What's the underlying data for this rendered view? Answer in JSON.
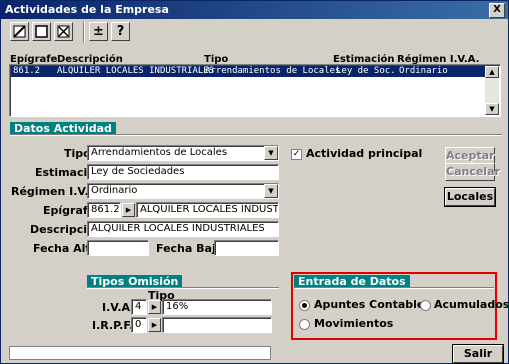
{
  "window": {
    "title": "Actividades de la Empresa",
    "close_glyph": "X"
  },
  "toolbar": {
    "plusminus": "±",
    "help": "?"
  },
  "grid": {
    "headers": [
      "Epígrafe",
      "Descripción",
      "Tipo",
      "Estimación",
      "Régimen I.V.A."
    ],
    "rows": [
      {
        "epigrafe": "861.2",
        "descripcion": "ALQUILER LOCALES INDUSTRIALES",
        "tipo": "Arrendamientos de Locales",
        "estimacion": "Ley de Soc.",
        "regimen": "Ordinario"
      }
    ]
  },
  "datos": {
    "tab": "Datos Actividad",
    "tipo_label": "Tipo",
    "tipo_value": "Arrendamientos de Locales",
    "estimacion_label": "Estimación",
    "estimacion_value": "Ley de Sociedades",
    "regimen_label": "Régimen I.V.A.",
    "regimen_value": "Ordinario",
    "epigrafe_label": "Epígrafe",
    "epigrafe_code": "861.2",
    "epigrafe_text": "ALQUILER LOCALES INDUSTRIA",
    "descripcion_label": "Descripción",
    "descripcion_value": "ALQUILER LOCALES INDUSTRIALES",
    "fecha_alta_label": "Fecha Alta",
    "fecha_alta_value": "",
    "fecha_baja_label": "Fecha Baja",
    "fecha_baja_value": "",
    "actividad_principal_label": "Actividad principal",
    "actividad_principal_checked": true
  },
  "buttons": {
    "aceptar": "Aceptar",
    "cancelar": "Cancelar",
    "locales": "Locales",
    "salir": "Salir"
  },
  "omision": {
    "tab": "Tipos Omisión",
    "tipo_header": "Tipo",
    "iva_label": "I.V.A.",
    "iva_code": "4",
    "iva_value": "16%",
    "irpf_label": "I.R.P.F.",
    "irpf_code": "0",
    "irpf_value": ""
  },
  "entrada": {
    "tab": "Entrada de Datos",
    "apuntes": "Apuntes Contables",
    "acumulados": "Acumulados",
    "movimientos": "Movimientos",
    "selected": "Apuntes Contables"
  },
  "status": {
    "text": ""
  }
}
